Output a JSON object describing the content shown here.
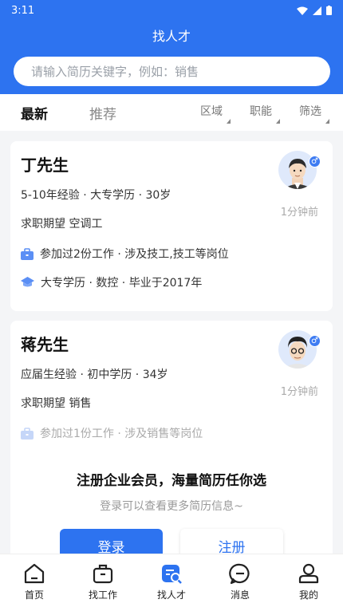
{
  "status": {
    "time": "3:11"
  },
  "header": {
    "title": "找人才",
    "search_placeholder": "请输入简历关键字，例如：销售"
  },
  "tabs": {
    "latest": "最新",
    "recommend": "推荐"
  },
  "filters": {
    "area": "区域",
    "function": "职能",
    "filter": "筛选"
  },
  "cards": [
    {
      "name": "丁先生",
      "info": "5-10年经验 · 大专学历 · 30岁",
      "expectation": "求职期望 空调工",
      "time": "1分钟前",
      "work": "参加过2份工作 · 涉及技工,技工等岗位",
      "education": "大专学历 · 数控 · 毕业于2017年"
    },
    {
      "name": "蒋先生",
      "info": "应届生经验 · 初中学历 · 34岁",
      "expectation": "求职期望 销售",
      "time": "1分钟前",
      "work": "参加过1份工作 · 涉及销售等岗位"
    }
  ],
  "promo": {
    "title": "注册企业会员，海量简历任你选",
    "subtitle": "登录可以查看更多简历信息~",
    "login": "登录",
    "register": "注册"
  },
  "nav": [
    {
      "label": "首页",
      "icon": "home-icon"
    },
    {
      "label": "找工作",
      "icon": "briefcase-icon"
    },
    {
      "label": "找人才",
      "icon": "talent-search-icon"
    },
    {
      "label": "消息",
      "icon": "message-icon"
    },
    {
      "label": "我的",
      "icon": "profile-icon"
    }
  ],
  "colors": {
    "primary": "#2d73f0",
    "background": "#f4f5f7"
  }
}
